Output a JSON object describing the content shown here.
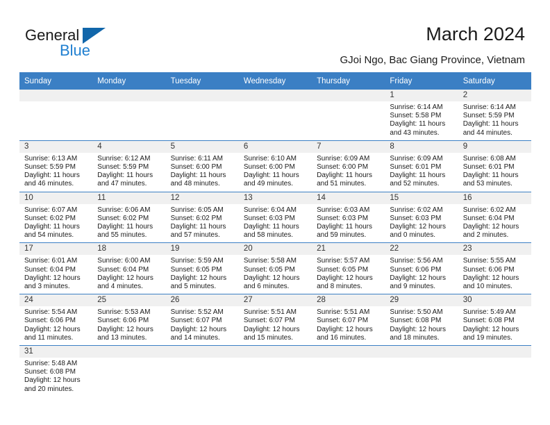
{
  "brand": {
    "name_part1": "General",
    "name_part2": "Blue",
    "logo_icon": "triangle-flag-icon"
  },
  "header": {
    "title": "March 2024",
    "subtitle": "GJoi Ngo, Bac Giang Province, Vietnam"
  },
  "colors": {
    "header_blue": "#3b7fc4",
    "brand_blue": "#1f7fd0",
    "daynum_band": "#f0f0f0",
    "text": "#1a1a1a"
  },
  "weekdays": [
    "Sunday",
    "Monday",
    "Tuesday",
    "Wednesday",
    "Thursday",
    "Friday",
    "Saturday"
  ],
  "labels": {
    "sunrise_prefix": "Sunrise:",
    "sunset_prefix": "Sunset:",
    "daylight_prefix": "Daylight:"
  },
  "weeks": [
    [
      {
        "day": "",
        "empty": true
      },
      {
        "day": "",
        "empty": true
      },
      {
        "day": "",
        "empty": true
      },
      {
        "day": "",
        "empty": true
      },
      {
        "day": "",
        "empty": true
      },
      {
        "day": "1",
        "sunrise": "Sunrise: 6:14 AM",
        "sunset": "Sunset: 5:58 PM",
        "daylight1": "Daylight: 11 hours",
        "daylight2": "and 43 minutes."
      },
      {
        "day": "2",
        "sunrise": "Sunrise: 6:14 AM",
        "sunset": "Sunset: 5:59 PM",
        "daylight1": "Daylight: 11 hours",
        "daylight2": "and 44 minutes."
      }
    ],
    [
      {
        "day": "3",
        "sunrise": "Sunrise: 6:13 AM",
        "sunset": "Sunset: 5:59 PM",
        "daylight1": "Daylight: 11 hours",
        "daylight2": "and 46 minutes."
      },
      {
        "day": "4",
        "sunrise": "Sunrise: 6:12 AM",
        "sunset": "Sunset: 5:59 PM",
        "daylight1": "Daylight: 11 hours",
        "daylight2": "and 47 minutes."
      },
      {
        "day": "5",
        "sunrise": "Sunrise: 6:11 AM",
        "sunset": "Sunset: 6:00 PM",
        "daylight1": "Daylight: 11 hours",
        "daylight2": "and 48 minutes."
      },
      {
        "day": "6",
        "sunrise": "Sunrise: 6:10 AM",
        "sunset": "Sunset: 6:00 PM",
        "daylight1": "Daylight: 11 hours",
        "daylight2": "and 49 minutes."
      },
      {
        "day": "7",
        "sunrise": "Sunrise: 6:09 AM",
        "sunset": "Sunset: 6:00 PM",
        "daylight1": "Daylight: 11 hours",
        "daylight2": "and 51 minutes."
      },
      {
        "day": "8",
        "sunrise": "Sunrise: 6:09 AM",
        "sunset": "Sunset: 6:01 PM",
        "daylight1": "Daylight: 11 hours",
        "daylight2": "and 52 minutes."
      },
      {
        "day": "9",
        "sunrise": "Sunrise: 6:08 AM",
        "sunset": "Sunset: 6:01 PM",
        "daylight1": "Daylight: 11 hours",
        "daylight2": "and 53 minutes."
      }
    ],
    [
      {
        "day": "10",
        "sunrise": "Sunrise: 6:07 AM",
        "sunset": "Sunset: 6:02 PM",
        "daylight1": "Daylight: 11 hours",
        "daylight2": "and 54 minutes."
      },
      {
        "day": "11",
        "sunrise": "Sunrise: 6:06 AM",
        "sunset": "Sunset: 6:02 PM",
        "daylight1": "Daylight: 11 hours",
        "daylight2": "and 55 minutes."
      },
      {
        "day": "12",
        "sunrise": "Sunrise: 6:05 AM",
        "sunset": "Sunset: 6:02 PM",
        "daylight1": "Daylight: 11 hours",
        "daylight2": "and 57 minutes."
      },
      {
        "day": "13",
        "sunrise": "Sunrise: 6:04 AM",
        "sunset": "Sunset: 6:03 PM",
        "daylight1": "Daylight: 11 hours",
        "daylight2": "and 58 minutes."
      },
      {
        "day": "14",
        "sunrise": "Sunrise: 6:03 AM",
        "sunset": "Sunset: 6:03 PM",
        "daylight1": "Daylight: 11 hours",
        "daylight2": "and 59 minutes."
      },
      {
        "day": "15",
        "sunrise": "Sunrise: 6:02 AM",
        "sunset": "Sunset: 6:03 PM",
        "daylight1": "Daylight: 12 hours",
        "daylight2": "and 0 minutes."
      },
      {
        "day": "16",
        "sunrise": "Sunrise: 6:02 AM",
        "sunset": "Sunset: 6:04 PM",
        "daylight1": "Daylight: 12 hours",
        "daylight2": "and 2 minutes."
      }
    ],
    [
      {
        "day": "17",
        "sunrise": "Sunrise: 6:01 AM",
        "sunset": "Sunset: 6:04 PM",
        "daylight1": "Daylight: 12 hours",
        "daylight2": "and 3 minutes."
      },
      {
        "day": "18",
        "sunrise": "Sunrise: 6:00 AM",
        "sunset": "Sunset: 6:04 PM",
        "daylight1": "Daylight: 12 hours",
        "daylight2": "and 4 minutes."
      },
      {
        "day": "19",
        "sunrise": "Sunrise: 5:59 AM",
        "sunset": "Sunset: 6:05 PM",
        "daylight1": "Daylight: 12 hours",
        "daylight2": "and 5 minutes."
      },
      {
        "day": "20",
        "sunrise": "Sunrise: 5:58 AM",
        "sunset": "Sunset: 6:05 PM",
        "daylight1": "Daylight: 12 hours",
        "daylight2": "and 6 minutes."
      },
      {
        "day": "21",
        "sunrise": "Sunrise: 5:57 AM",
        "sunset": "Sunset: 6:05 PM",
        "daylight1": "Daylight: 12 hours",
        "daylight2": "and 8 minutes."
      },
      {
        "day": "22",
        "sunrise": "Sunrise: 5:56 AM",
        "sunset": "Sunset: 6:06 PM",
        "daylight1": "Daylight: 12 hours",
        "daylight2": "and 9 minutes."
      },
      {
        "day": "23",
        "sunrise": "Sunrise: 5:55 AM",
        "sunset": "Sunset: 6:06 PM",
        "daylight1": "Daylight: 12 hours",
        "daylight2": "and 10 minutes."
      }
    ],
    [
      {
        "day": "24",
        "sunrise": "Sunrise: 5:54 AM",
        "sunset": "Sunset: 6:06 PM",
        "daylight1": "Daylight: 12 hours",
        "daylight2": "and 11 minutes."
      },
      {
        "day": "25",
        "sunrise": "Sunrise: 5:53 AM",
        "sunset": "Sunset: 6:06 PM",
        "daylight1": "Daylight: 12 hours",
        "daylight2": "and 13 minutes."
      },
      {
        "day": "26",
        "sunrise": "Sunrise: 5:52 AM",
        "sunset": "Sunset: 6:07 PM",
        "daylight1": "Daylight: 12 hours",
        "daylight2": "and 14 minutes."
      },
      {
        "day": "27",
        "sunrise": "Sunrise: 5:51 AM",
        "sunset": "Sunset: 6:07 PM",
        "daylight1": "Daylight: 12 hours",
        "daylight2": "and 15 minutes."
      },
      {
        "day": "28",
        "sunrise": "Sunrise: 5:51 AM",
        "sunset": "Sunset: 6:07 PM",
        "daylight1": "Daylight: 12 hours",
        "daylight2": "and 16 minutes."
      },
      {
        "day": "29",
        "sunrise": "Sunrise: 5:50 AM",
        "sunset": "Sunset: 6:08 PM",
        "daylight1": "Daylight: 12 hours",
        "daylight2": "and 18 minutes."
      },
      {
        "day": "30",
        "sunrise": "Sunrise: 5:49 AM",
        "sunset": "Sunset: 6:08 PM",
        "daylight1": "Daylight: 12 hours",
        "daylight2": "and 19 minutes."
      }
    ],
    [
      {
        "day": "31",
        "sunrise": "Sunrise: 5:48 AM",
        "sunset": "Sunset: 6:08 PM",
        "daylight1": "Daylight: 12 hours",
        "daylight2": "and 20 minutes."
      },
      {
        "day": "",
        "empty": true
      },
      {
        "day": "",
        "empty": true
      },
      {
        "day": "",
        "empty": true
      },
      {
        "day": "",
        "empty": true
      },
      {
        "day": "",
        "empty": true
      },
      {
        "day": "",
        "empty": true
      }
    ]
  ]
}
